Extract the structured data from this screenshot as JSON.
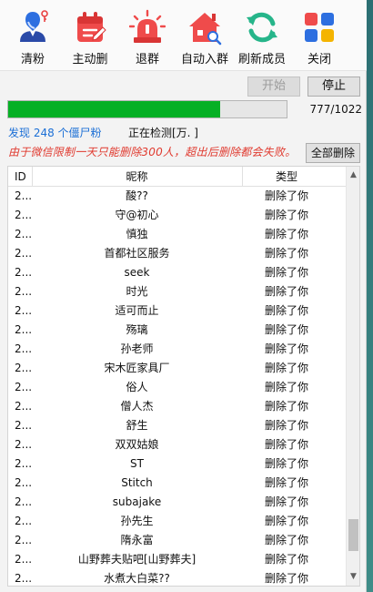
{
  "toolbar": {
    "items": [
      {
        "label": "清粉",
        "icon": "person-pin-icon"
      },
      {
        "label": "主动删",
        "icon": "calendar-delete-icon"
      },
      {
        "label": "退群",
        "icon": "alarm-siren-icon"
      },
      {
        "label": "自动入群",
        "icon": "house-search-icon"
      },
      {
        "label": "刷新成员",
        "icon": "refresh-icon"
      },
      {
        "label": "关闭",
        "icon": "grid-apps-icon"
      }
    ]
  },
  "controls": {
    "start_label": "开始",
    "stop_label": "停止",
    "delete_all_label": "全部删除"
  },
  "progress": {
    "current": 777,
    "total": 1022,
    "text": "777/1022",
    "fill_fraction": 0.76
  },
  "status": {
    "found_text": "发现 248 个僵尸粉",
    "detecting_text": "正在检测[万. ]",
    "warning_text": "由于微信限制一天只能删除300人，超出后删除都会失败。"
  },
  "table": {
    "headers": {
      "id": "ID",
      "name": "昵称",
      "type": "类型"
    },
    "rows": [
      {
        "id": "2...",
        "name": "酸??",
        "type": "删除了你"
      },
      {
        "id": "2...",
        "name": "守@初心",
        "type": "删除了你"
      },
      {
        "id": "2...",
        "name": "慎独",
        "type": "删除了你"
      },
      {
        "id": "2...",
        "name": "首都社区服务",
        "type": "删除了你"
      },
      {
        "id": "2...",
        "name": "seek",
        "type": "删除了你"
      },
      {
        "id": "2...",
        "name": "时光",
        "type": "删除了你"
      },
      {
        "id": "2...",
        "name": "适可而止",
        "type": "删除了你"
      },
      {
        "id": "2...",
        "name": "殇璃",
        "type": "删除了你"
      },
      {
        "id": "2...",
        "name": "孙老师",
        "type": "删除了你"
      },
      {
        "id": "2...",
        "name": "宋木匠家具厂",
        "type": "删除了你"
      },
      {
        "id": "2...",
        "name": "俗人",
        "type": "删除了你"
      },
      {
        "id": "2...",
        "name": "僧人杰",
        "type": "删除了你"
      },
      {
        "id": "2...",
        "name": "舒生",
        "type": "删除了你"
      },
      {
        "id": "2...",
        "name": "双双姑娘",
        "type": "删除了你"
      },
      {
        "id": "2...",
        "name": "ST",
        "type": "删除了你"
      },
      {
        "id": "2...",
        "name": "Stitch",
        "type": "删除了你"
      },
      {
        "id": "2...",
        "name": "subajake",
        "type": "删除了你"
      },
      {
        "id": "2...",
        "name": "孙先生",
        "type": "删除了你"
      },
      {
        "id": "2...",
        "name": "隋永富",
        "type": "删除了你"
      },
      {
        "id": "2...",
        "name": "山野葬夫贴吧[山野葬夫]",
        "type": "删除了你"
      },
      {
        "id": "2...",
        "name": "水煮大白菜??",
        "type": "删除了你"
      }
    ]
  },
  "colors": {
    "progress_green": "#06b025",
    "link_blue": "#1b6fd6",
    "warning_red": "#e03a2f"
  }
}
